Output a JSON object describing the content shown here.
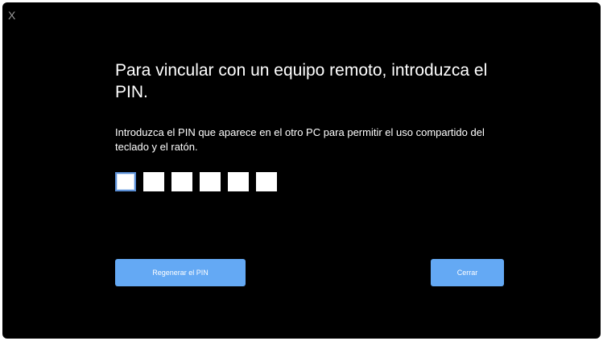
{
  "window": {
    "close_label": "X"
  },
  "title": "Para vincular con un equipo remoto, introduzca el PIN.",
  "description": "Introduzca el PIN que aparece en el otro PC para permitir el uso compartido del teclado y el ratón.",
  "pin": {
    "digits": [
      "",
      "",
      "",
      "",
      "",
      ""
    ],
    "active_index": 0
  },
  "buttons": {
    "regenerate_label": "Regenerar el PIN",
    "close_label": "Cerrar"
  },
  "colors": {
    "background": "#000000",
    "button": "#64a9f4",
    "text": "#ffffff",
    "focus_border": "#5b8fd6"
  },
  "icons": {
    "close": "close-icon"
  }
}
